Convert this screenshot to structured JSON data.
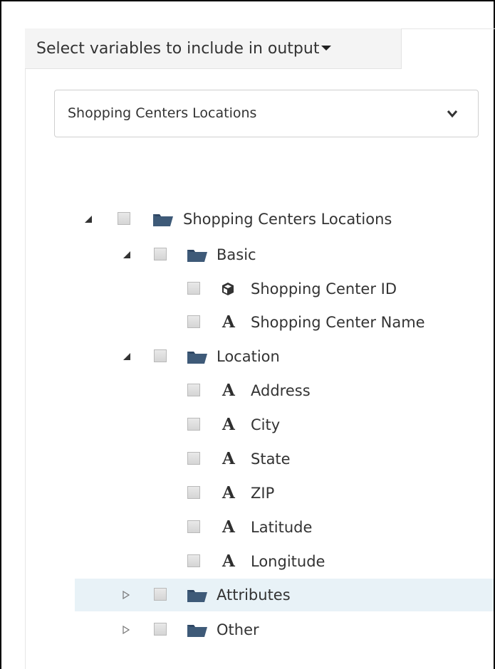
{
  "header": {
    "select_variables_label": "Select variables to include in output"
  },
  "dataset_dropdown": {
    "selected": "Shopping Centers Locations"
  },
  "tree": {
    "root": {
      "label": "Shopping Centers Locations",
      "expanded": true
    },
    "basic": {
      "label": "Basic",
      "expanded": true
    },
    "basic_items": [
      {
        "label": "Shopping Center ID",
        "icon": "cube-icon"
      },
      {
        "label": "Shopping Center Name",
        "icon": "text-type-icon"
      }
    ],
    "location": {
      "label": "Location",
      "expanded": true
    },
    "location_items": [
      {
        "label": "Address",
        "icon": "text-type-icon"
      },
      {
        "label": "City",
        "icon": "text-type-icon"
      },
      {
        "label": "State",
        "icon": "text-type-icon"
      },
      {
        "label": "ZIP",
        "icon": "text-type-icon"
      },
      {
        "label": "Latitude",
        "icon": "text-type-icon"
      },
      {
        "label": "Longitude",
        "icon": "text-type-icon"
      }
    ],
    "attributes": {
      "label": "Attributes",
      "expanded": false
    },
    "other": {
      "label": "Other",
      "expanded": false
    },
    "type_glyph": "A"
  },
  "colors": {
    "folder": "#3e5a78",
    "highlight": "#e8f2f7",
    "text": "#333333"
  }
}
